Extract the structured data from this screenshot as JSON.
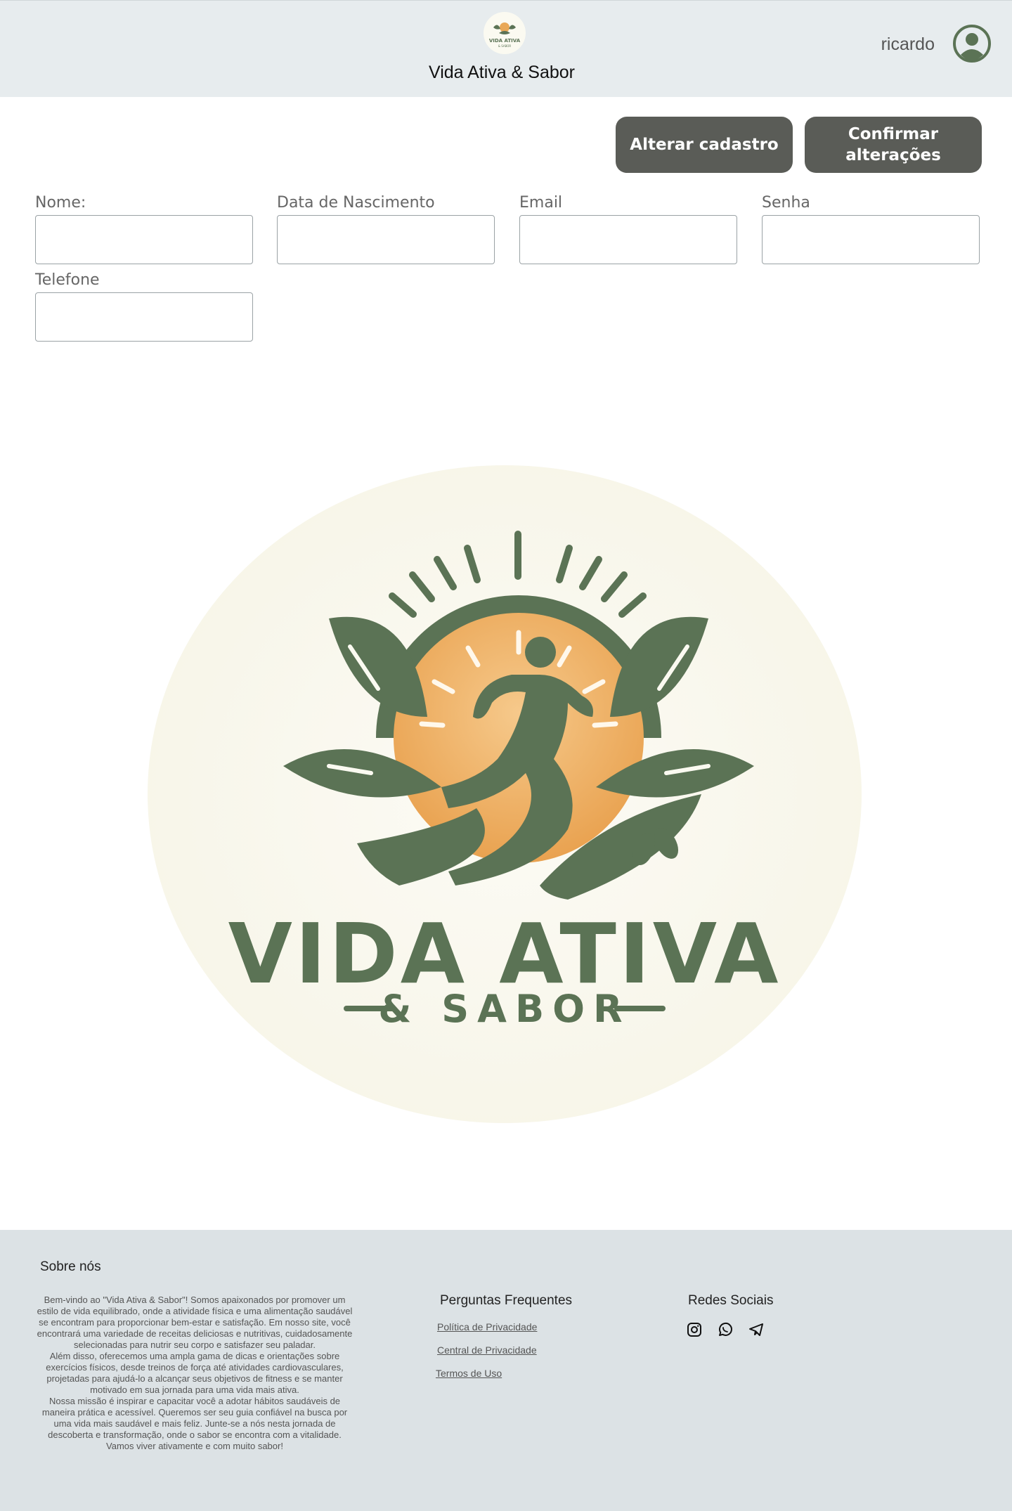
{
  "header": {
    "title": "Vida Ativa & Sabor",
    "user_name": "ricardo",
    "logo_text_top": "VIDA ATIVA",
    "logo_text_bottom": "& SABOR"
  },
  "actions": {
    "alter_label": "Alterar cadastro",
    "confirm_label": "Confirmar alterações"
  },
  "form": {
    "fields": [
      {
        "label": "Nome:",
        "value": ""
      },
      {
        "label": "Data de Nascimento",
        "value": ""
      },
      {
        "label": "Email",
        "value": ""
      },
      {
        "label": "Senha",
        "value": ""
      },
      {
        "label": "Telefone",
        "value": ""
      }
    ]
  },
  "brand": {
    "name_line1": "VIDA ATIVA",
    "name_line2": "& SABOR"
  },
  "footer": {
    "about_title": "Sobre nós",
    "about_paragraphs": [
      "Bem-vindo ao \"Vida Ativa & Sabor\"! Somos apaixonados por promover um estilo de vida equilibrado, onde a atividade física e uma alimentação saudável se encontram para proporcionar bem-estar e satisfação. Em nosso site, você encontrará uma variedade de receitas deliciosas e nutritivas, cuidadosamente selecionadas para nutrir seu corpo e satisfazer seu paladar.",
      "Além disso, oferecemos uma ampla gama de dicas e orientações sobre exercícios físicos, desde treinos de força até atividades cardiovasculares, projetadas para ajudá-lo a alcançar seus objetivos de fitness e se manter motivado em sua jornada para uma vida mais ativa.",
      "Nossa missão é inspirar e capacitar você a adotar hábitos saudáveis de maneira prática e acessível. Queremos ser seu guia confiável na busca por uma vida mais saudável e mais feliz. Junte-se a nós nesta jornada de descoberta e transformação, onde o sabor se encontra com a vitalidade. Vamos viver ativamente e com muito sabor!"
    ],
    "faq_title": "Perguntas Frequentes",
    "links": [
      "Política de Privacidade",
      "Central de Privacidade",
      "Termos de Uso"
    ],
    "social_title": "Redes Sociais",
    "social_icons": [
      "instagram-icon",
      "whatsapp-icon",
      "telegram-icon"
    ]
  },
  "colors": {
    "header_bg": "#e7ecee",
    "button_bg": "#5a5c57",
    "brand_green": "#5b7355",
    "sun_orange": "#e9a857",
    "logo_cream": "#fbfaf1",
    "footer_bg": "#dce2e5"
  }
}
